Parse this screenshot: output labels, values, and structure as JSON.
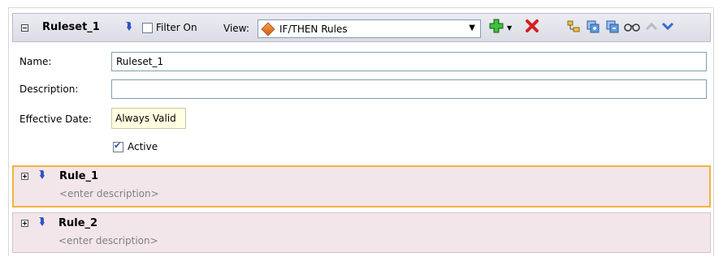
{
  "ruleset": {
    "name": "Ruleset_1",
    "filter_label": "Filter On",
    "view_label": "View:",
    "view_value": "IF/THEN Rules"
  },
  "form": {
    "name_label": "Name:",
    "name_value": "Ruleset_1",
    "description_label": "Description:",
    "description_value": "",
    "effective_date_label": "Effective Date:",
    "effective_date_value": "Always Valid",
    "active_label": "Active"
  },
  "rules": [
    {
      "name": "Rule_1",
      "description": "<enter description>",
      "selected": true
    },
    {
      "name": "Rule_2",
      "description": "<enter description>",
      "selected": false
    }
  ],
  "toolbar": {
    "add_icon": "add-icon",
    "delete_icon": "delete-icon",
    "tool_icons": [
      "hierarchy-icon",
      "copy-icon",
      "paste-icon",
      "view-glasses-icon",
      "collapse-up-icon",
      "expand-down-icon"
    ]
  },
  "colors": {
    "rule_bg": "#f3e6ea",
    "selected_border": "#f3b23c",
    "link_blue": "#2f55c9"
  }
}
